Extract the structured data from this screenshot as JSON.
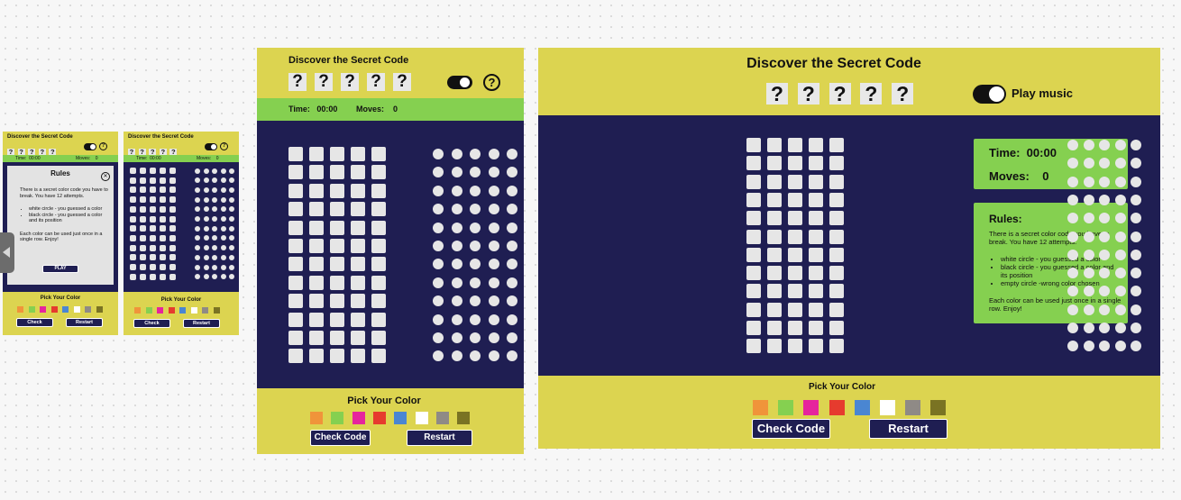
{
  "game": {
    "title": "Discover the Secret Code",
    "secret_symbols": [
      "?",
      "?",
      "?",
      "?",
      "?"
    ],
    "help_symbol": "?",
    "time_label": "Time:",
    "time_value": "00:00",
    "moves_label": "Moves:",
    "moves_value": "0",
    "pick_color_label": "Pick Your Color",
    "check_button_small": "Check",
    "check_button": "Check Code",
    "restart_button": "Restart",
    "play_music_label": "Play music",
    "colors": [
      "#f0943a",
      "#85d050",
      "#e6249d",
      "#e63b2e",
      "#4a86d2",
      "#ffffff",
      "#8f8a86",
      "#7a7323"
    ],
    "board_rows": 12,
    "code_length": 5
  },
  "rules_modal": {
    "title": "Rules",
    "close_icon": "close-icon",
    "intro": "There is a secret color code you have to break. You have 12 attempts.",
    "items": [
      "white circle - you guessed a color",
      "black circle - you guessed a color and its position"
    ],
    "footer": "Each color can be used just once in a single row. Enjoy!",
    "play_button": "PLAY"
  },
  "rules_panel": {
    "title": "Rules:",
    "intro": "There is a secret color code you have to break. You have 12 attempts.",
    "items": [
      "white circle - you guessed a color",
      "black circle - you guessed a color and its position",
      "empty circle -wrong color chosen"
    ],
    "footer": "Each color can be used just once in a single row. Enjoy!"
  },
  "side_handle_icon": "chevron-left-icon"
}
